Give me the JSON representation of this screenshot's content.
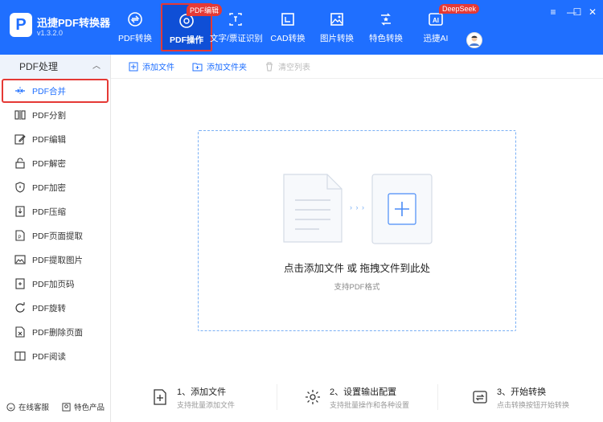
{
  "app": {
    "logo_letter": "P",
    "title": "迅捷PDF转换器",
    "version": "v1.3.2.0"
  },
  "nav": {
    "tabs": [
      {
        "label": "PDF转换",
        "icon": "pdf-convert-icon"
      },
      {
        "label": "PDF操作",
        "icon": "pdf-operate-icon",
        "badge": "PDF编辑",
        "active": true
      },
      {
        "label": "文字/票证识别",
        "icon": "ocr-icon"
      },
      {
        "label": "CAD转换",
        "icon": "cad-icon"
      },
      {
        "label": "图片转换",
        "icon": "image-icon"
      },
      {
        "label": "特色转换",
        "icon": "special-icon"
      },
      {
        "label": "迅捷AI",
        "icon": "ai-icon",
        "badge": "DeepSeek"
      }
    ]
  },
  "window": {
    "menu": "≡",
    "minimize": "—",
    "maximize": "☐",
    "close": "✕"
  },
  "sidebar": {
    "header": "PDF处理",
    "items": [
      {
        "label": "PDF合并",
        "active": true
      },
      {
        "label": "PDF分割"
      },
      {
        "label": "PDF编辑"
      },
      {
        "label": "PDF解密"
      },
      {
        "label": "PDF加密"
      },
      {
        "label": "PDF压缩"
      },
      {
        "label": "PDF页面提取"
      },
      {
        "label": "PDF提取图片"
      },
      {
        "label": "PDF加页码"
      },
      {
        "label": "PDF旋转"
      },
      {
        "label": "PDF删除页面"
      },
      {
        "label": "PDF阅读"
      }
    ],
    "footer": {
      "service": "在线客服",
      "products": "特色产品"
    }
  },
  "toolbar": {
    "add_file": "添加文件",
    "add_folder": "添加文件夹",
    "clear_list": "清空列表"
  },
  "dropzone": {
    "main_text": "点击添加文件 或 拖拽文件到此处",
    "sub_text": "支持PDF格式",
    "arrows": "› › ›"
  },
  "steps": [
    {
      "title": "1、添加文件",
      "desc": "支持批量添加文件"
    },
    {
      "title": "2、设置输出配置",
      "desc": "支持批量操作和各种设置"
    },
    {
      "title": "3、开始转换",
      "desc": "点击转换按钮开始转换"
    }
  ],
  "colors": {
    "brand": "#1f6fff",
    "highlight": "#e53935",
    "dashed_border": "#7ab0f5"
  }
}
